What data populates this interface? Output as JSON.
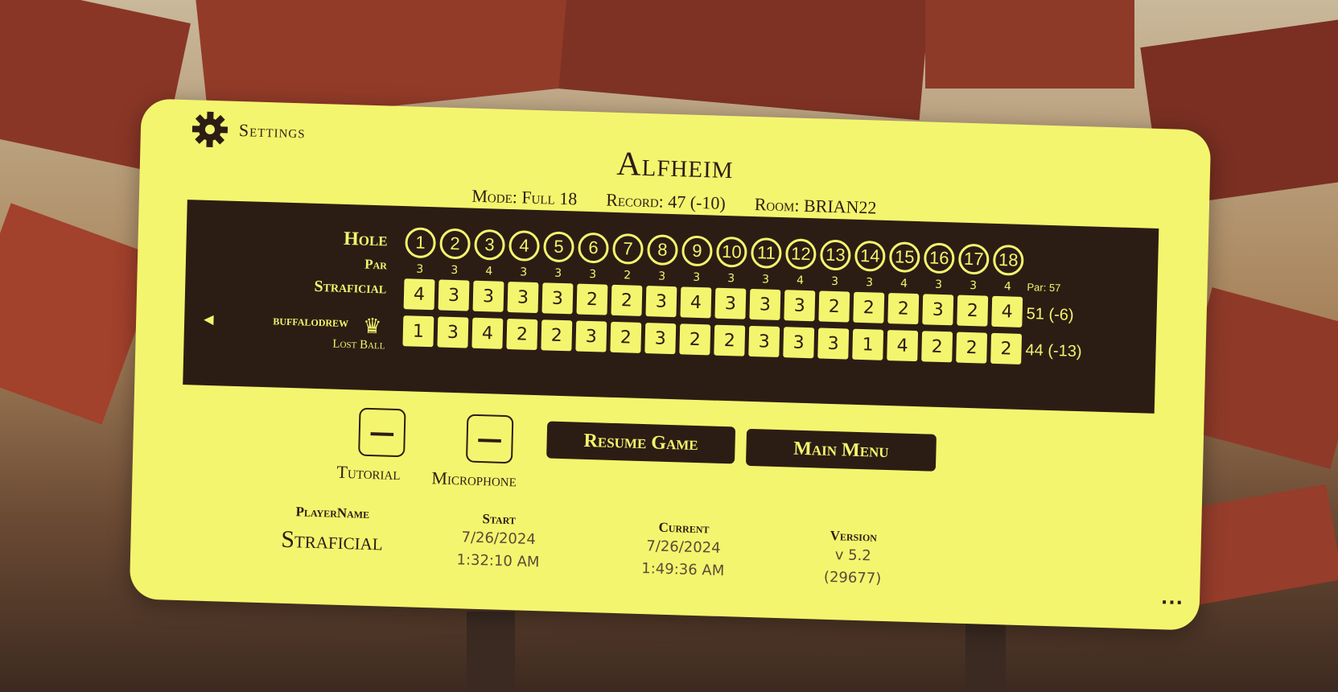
{
  "settings": {
    "label": "Settings",
    "icon": "gear-icon"
  },
  "course": {
    "name": "Alfheim"
  },
  "info": {
    "mode": "Mode: Full 18",
    "record": "Record: 47 (-10)",
    "room": "Room: BRIAN22"
  },
  "scoreboard": {
    "hole_label": "Hole",
    "par_label": "Par",
    "holes": [
      "1",
      "2",
      "3",
      "4",
      "5",
      "6",
      "7",
      "8",
      "9",
      "10",
      "11",
      "12",
      "13",
      "14",
      "15",
      "16",
      "17",
      "18"
    ],
    "pars": [
      "3",
      "3",
      "4",
      "3",
      "3",
      "3",
      "2",
      "3",
      "3",
      "3",
      "3",
      "4",
      "3",
      "3",
      "4",
      "3",
      "3",
      "4"
    ],
    "par_total": "Par: 57",
    "players": [
      {
        "name": "Straficial",
        "scores": [
          "4",
          "3",
          "3",
          "3",
          "3",
          "2",
          "2",
          "3",
          "4",
          "3",
          "3",
          "3",
          "2",
          "2",
          "2",
          "3",
          "2",
          "4"
        ],
        "total": "51 (-6)"
      },
      {
        "name": "buffalodrew",
        "scores": [
          "1",
          "3",
          "4",
          "2",
          "2",
          "3",
          "2",
          "3",
          "2",
          "2",
          "3",
          "3",
          "3",
          "1",
          "4",
          "2",
          "2",
          "2"
        ],
        "total": "44 (-13)",
        "status": "Lost Ball"
      }
    ]
  },
  "controls": {
    "tutorial": {
      "label": "Tutorial",
      "symbol": "—"
    },
    "microphone": {
      "label": "Microphone",
      "symbol": "—"
    },
    "resume": "Resume Game",
    "main_menu": "Main Menu"
  },
  "footer": {
    "player_name_label": "PlayerName",
    "player_name": "Straficial",
    "start_label": "Start",
    "start_date": "7/26/2024",
    "start_time": "1:32:10 AM",
    "current_label": "Current",
    "current_date": "7/26/2024",
    "current_time": "1:49:36 AM",
    "version_label": "Version",
    "version": "v 5.2",
    "build": "(29677)",
    "more": "..."
  },
  "colors": {
    "panel": "#f4f56e",
    "dark": "#2b1d14"
  }
}
